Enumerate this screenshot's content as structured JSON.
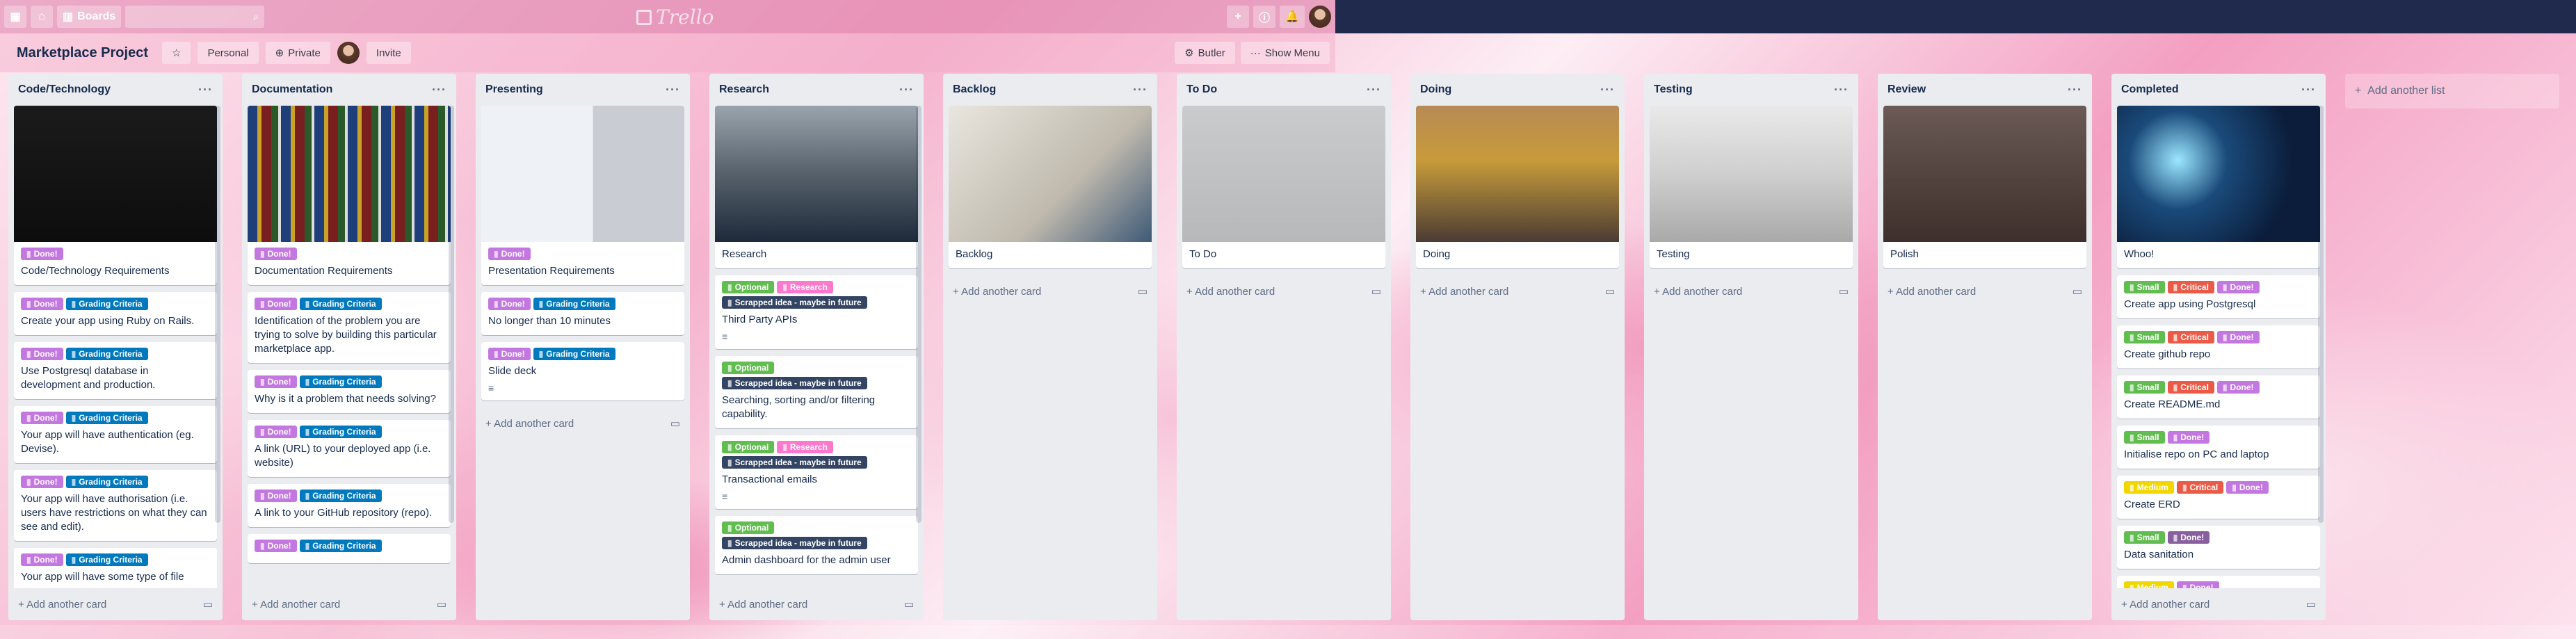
{
  "topbar": {
    "boards_label": "Boards",
    "logo": "Trello",
    "icons": [
      "apps-icon",
      "home-icon",
      "search-icon",
      "plus-icon",
      "info-icon",
      "bell-icon"
    ]
  },
  "board": {
    "title": "Marketplace Project",
    "visibility_team": "Personal",
    "visibility": "Private",
    "invite": "Invite",
    "butler": "Butler",
    "show_menu": "Show Menu"
  },
  "colors": {
    "done": "#c377e0",
    "grading": "#0079bf",
    "optional": "#61bd4f",
    "research": "#ff78cb",
    "scrapped": "#344563",
    "small": "#61bd4f",
    "critical": "#eb5a46",
    "medium": "#f2d600",
    "purple": "#89609e"
  },
  "ui": {
    "add_card": "Add another card",
    "add_list": "Add another list"
  },
  "lists": [
    {
      "name": "Code/Technology",
      "cover": "code",
      "cards": [
        {
          "labels": [
            {
              "t": "Done!",
              "c": "done"
            }
          ],
          "title": "Code/Technology Requirements",
          "cover": true
        },
        {
          "labels": [
            {
              "t": "Done!",
              "c": "done"
            },
            {
              "t": "Grading Criteria",
              "c": "grading"
            }
          ],
          "title": "Create your app using Ruby on Rails."
        },
        {
          "labels": [
            {
              "t": "Done!",
              "c": "done"
            },
            {
              "t": "Grading Criteria",
              "c": "grading"
            }
          ],
          "title": "Use Postgresql database in development and production."
        },
        {
          "labels": [
            {
              "t": "Done!",
              "c": "done"
            },
            {
              "t": "Grading Criteria",
              "c": "grading"
            }
          ],
          "title": "Your app will have authentication (eg. Devise)."
        },
        {
          "labels": [
            {
              "t": "Done!",
              "c": "done"
            },
            {
              "t": "Grading Criteria",
              "c": "grading"
            }
          ],
          "title": "Your app will have authorisation (i.e. users have restrictions on what they can see and edit)."
        },
        {
          "labels": [
            {
              "t": "Done!",
              "c": "done"
            },
            {
              "t": "Grading Criteria",
              "c": "grading"
            }
          ],
          "title": "Your app will have some type of file"
        }
      ]
    },
    {
      "name": "Documentation",
      "cover": "docs",
      "cards": [
        {
          "labels": [
            {
              "t": "Done!",
              "c": "done"
            }
          ],
          "title": "Documentation Requirements",
          "cover": true
        },
        {
          "labels": [
            {
              "t": "Done!",
              "c": "done"
            },
            {
              "t": "Grading Criteria",
              "c": "grading"
            }
          ],
          "title": "Identification of the problem you are trying to solve by building this particular marketplace app."
        },
        {
          "labels": [
            {
              "t": "Done!",
              "c": "done"
            },
            {
              "t": "Grading Criteria",
              "c": "grading"
            }
          ],
          "title": "Why is it a problem that needs solving?"
        },
        {
          "labels": [
            {
              "t": "Done!",
              "c": "done"
            },
            {
              "t": "Grading Criteria",
              "c": "grading"
            }
          ],
          "title": "A link (URL) to your deployed app (i.e. website)"
        },
        {
          "labels": [
            {
              "t": "Done!",
              "c": "done"
            },
            {
              "t": "Grading Criteria",
              "c": "grading"
            }
          ],
          "title": "A link to your GitHub repository (repo)."
        },
        {
          "labels": [
            {
              "t": "Done!",
              "c": "done"
            },
            {
              "t": "Grading Criteria",
              "c": "grading"
            }
          ],
          "title": ""
        }
      ]
    },
    {
      "name": "Presenting",
      "cover": "present",
      "short": true,
      "cards": [
        {
          "labels": [
            {
              "t": "Done!",
              "c": "done"
            }
          ],
          "title": "Presentation Requirements",
          "cover": true
        },
        {
          "labels": [
            {
              "t": "Done!",
              "c": "done"
            },
            {
              "t": "Grading Criteria",
              "c": "grading"
            }
          ],
          "title": "No longer than 10 minutes"
        },
        {
          "labels": [
            {
              "t": "Done!",
              "c": "done"
            },
            {
              "t": "Grading Criteria",
              "c": "grading"
            }
          ],
          "title": "Slide deck",
          "desc": true
        }
      ]
    },
    {
      "name": "Research",
      "cover": "research",
      "cards": [
        {
          "labels": [],
          "title": "Research",
          "cover": true
        },
        {
          "labels": [
            {
              "t": "Optional",
              "c": "optional"
            },
            {
              "t": "Research",
              "c": "research"
            },
            {
              "t": "Scrapped idea - maybe in future",
              "c": "scrapped"
            }
          ],
          "title": "Third Party APIs",
          "desc": true
        },
        {
          "labels": [
            {
              "t": "Optional",
              "c": "optional"
            },
            {
              "t": "Scrapped idea - maybe in future",
              "c": "scrapped"
            }
          ],
          "title": "Searching, sorting and/or filtering capability."
        },
        {
          "labels": [
            {
              "t": "Optional",
              "c": "optional"
            },
            {
              "t": "Research",
              "c": "research"
            },
            {
              "t": "Scrapped idea - maybe in future",
              "c": "scrapped"
            }
          ],
          "title": "Transactional emails",
          "desc": true
        },
        {
          "labels": [
            {
              "t": "Optional",
              "c": "optional"
            },
            {
              "t": "Scrapped idea - maybe in future",
              "c": "scrapped"
            }
          ],
          "title": "Admin dashboard for the admin user"
        }
      ]
    },
    {
      "name": "Backlog",
      "cover": "backlog",
      "short": true,
      "cards": [
        {
          "labels": [],
          "title": "Backlog",
          "cover": true
        }
      ]
    },
    {
      "name": "To Do",
      "cover": "todo",
      "short": true,
      "cards": [
        {
          "labels": [],
          "title": "To Do",
          "cover": true
        }
      ]
    },
    {
      "name": "Doing",
      "cover": "doing",
      "short": true,
      "cards": [
        {
          "labels": [],
          "title": "Doing",
          "cover": true
        }
      ]
    },
    {
      "name": "Testing",
      "cover": "testing",
      "short": true,
      "cards": [
        {
          "labels": [],
          "title": "Testing",
          "cover": true
        }
      ]
    },
    {
      "name": "Review",
      "cover": "review",
      "short": true,
      "cards": [
        {
          "labels": [],
          "title": "Polish",
          "cover": true
        }
      ]
    },
    {
      "name": "Completed",
      "cover": "completed",
      "cards": [
        {
          "labels": [],
          "title": "Whoo!",
          "cover": true
        },
        {
          "labels": [
            {
              "t": "Small",
              "c": "small"
            },
            {
              "t": "Critical",
              "c": "critical"
            },
            {
              "t": "Done!",
              "c": "done"
            }
          ],
          "title": "Create app using Postgresql"
        },
        {
          "labels": [
            {
              "t": "Small",
              "c": "small"
            },
            {
              "t": "Critical",
              "c": "critical"
            },
            {
              "t": "Done!",
              "c": "done"
            }
          ],
          "title": "Create github repo"
        },
        {
          "labels": [
            {
              "t": "Small",
              "c": "small"
            },
            {
              "t": "Critical",
              "c": "critical"
            },
            {
              "t": "Done!",
              "c": "done"
            }
          ],
          "title": "Create README.md"
        },
        {
          "labels": [
            {
              "t": "Small",
              "c": "small"
            },
            {
              "t": "Done!",
              "c": "done"
            }
          ],
          "title": "Initialise repo on PC and laptop"
        },
        {
          "labels": [
            {
              "t": "Medium",
              "c": "medium"
            },
            {
              "t": "Critical",
              "c": "critical"
            },
            {
              "t": "Done!",
              "c": "done"
            }
          ],
          "title": "Create ERD"
        },
        {
          "labels": [
            {
              "t": "Small",
              "c": "small"
            },
            {
              "t": "Done!",
              "c": "purple"
            }
          ],
          "title": "Data sanitation"
        },
        {
          "labels": [
            {
              "t": "Medium",
              "c": "medium"
            },
            {
              "t": "Done!",
              "c": "done"
            }
          ],
          "title": ""
        }
      ]
    }
  ]
}
